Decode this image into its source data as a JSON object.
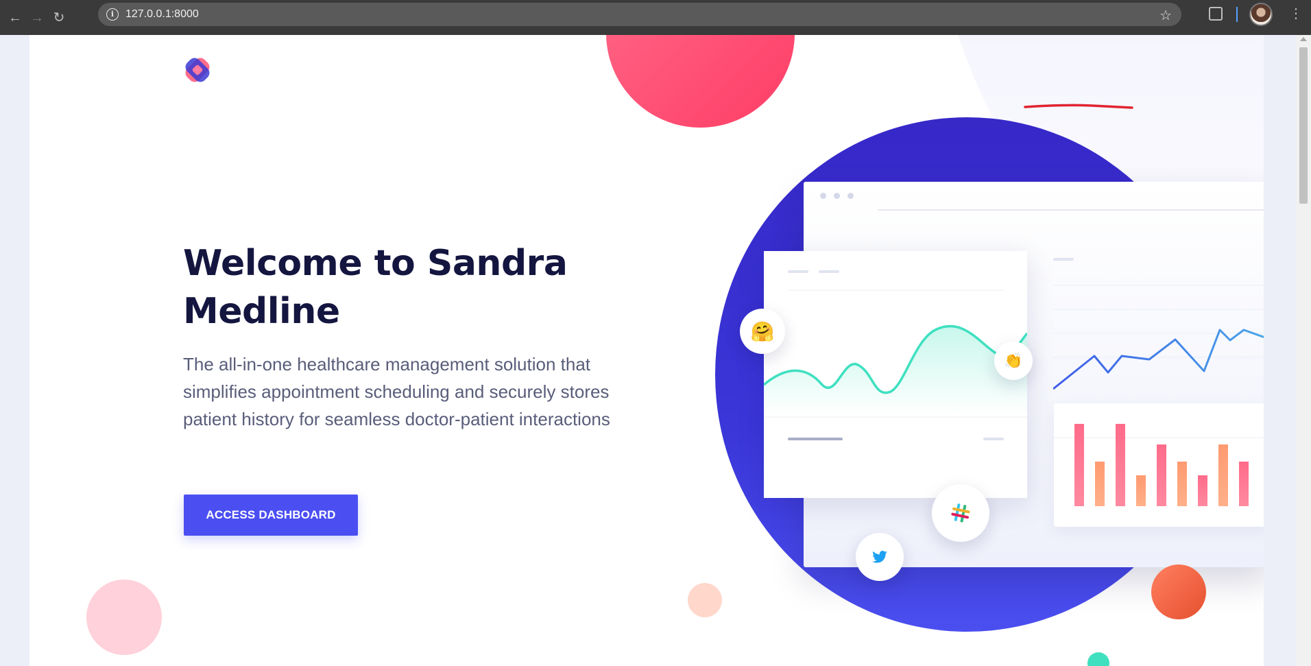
{
  "browser": {
    "url": "127.0.0.1:8000",
    "back_icon": "arrow-left",
    "forward_icon": "arrow-right",
    "reload_icon": "reload",
    "info_icon": "info",
    "star_icon": "star",
    "menu_icon": "more-vertical"
  },
  "hero": {
    "title": "Welcome to Sandra Medline",
    "description": "The all-in-one healthcare management solution that simplifies appointment scheduling and securely stores patient history for seamless doctor-patient interactions",
    "cta_label": "ACCESS DASHBOARD"
  },
  "illustration": {
    "emoji_smile": "🤗",
    "emoji_hands": "👏",
    "slack_icon": "slack",
    "twitter_icon": "twitter"
  },
  "colors": {
    "accent": "#4b4ff2",
    "headline": "#141640",
    "circle": "#3728c8",
    "deco_red": "#ff3d66",
    "bar_pink": "#ff6b8a",
    "bar_orange": "#ff9966",
    "wave_teal": "#3fe0c0",
    "line_blue": "#4a78f0"
  }
}
